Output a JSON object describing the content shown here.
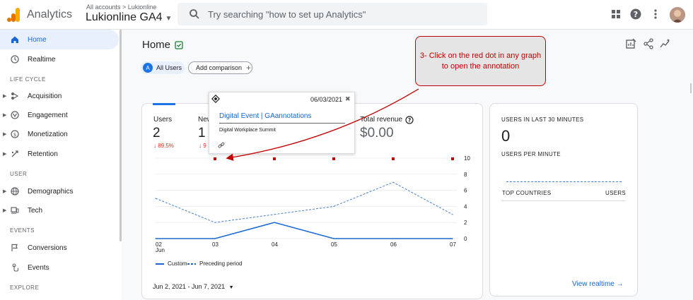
{
  "topbar": {
    "app_name": "Analytics",
    "breadcrumb": "All accounts > Lukionline",
    "property": "Lukionline GA4",
    "search_placeholder": "Try searching \"how to set up Analytics\""
  },
  "sidebar": {
    "items": [
      {
        "label": "Home"
      },
      {
        "label": "Realtime"
      },
      {
        "label": "Acquisition"
      },
      {
        "label": "Engagement"
      },
      {
        "label": "Monetization"
      },
      {
        "label": "Retention"
      },
      {
        "label": "Demographics"
      },
      {
        "label": "Tech"
      },
      {
        "label": "Conversions"
      },
      {
        "label": "Events"
      }
    ],
    "sections": [
      "LIFE CYCLE",
      "USER",
      "EVENTS",
      "EXPLORE"
    ]
  },
  "home": {
    "title": "Home",
    "chip_users_letter": "A",
    "chip_users": "All Users",
    "add_comparison": "Add comparison"
  },
  "metrics": {
    "users_label": "Users",
    "users_value": "2",
    "users_change": "↓ 89.5%",
    "new_label": "New",
    "new_value": "1",
    "new_change": "↓ 9",
    "revenue_label": "Total revenue",
    "revenue_value": "$0.00"
  },
  "annotation": {
    "date": "06/03/2021",
    "close": "✖",
    "title": "Digital Event | GAannotations",
    "subtitle": "Digital Workplace Summit"
  },
  "callout": "3- Click on the red dot in any graph to open the annotation",
  "chart_data": {
    "type": "line",
    "categories": [
      "02 Jun",
      "03",
      "04",
      "05",
      "06",
      "07"
    ],
    "x_tick_top": [
      "02",
      "03",
      "04",
      "05",
      "06",
      "07"
    ],
    "x_tick_sub": [
      "Jun",
      "",
      "",
      "",
      "",
      ""
    ],
    "series": [
      {
        "name": "Custom",
        "values": [
          0,
          0,
          2,
          0,
          0,
          0
        ],
        "style": "solid",
        "color": "#1967d2"
      },
      {
        "name": "Preceding period",
        "values": [
          5,
          2,
          3,
          4,
          7,
          3
        ],
        "style": "dashed",
        "color": "#4a80c8"
      }
    ],
    "y_right_ticks": [
      "10",
      "8",
      "6",
      "4",
      "2",
      "0"
    ],
    "annotation_markers": [
      "03",
      "04",
      "05",
      "06",
      "07"
    ],
    "marker_color": "#c00000",
    "date_range": "Jun 2, 2021 - Jun 7, 2021"
  },
  "realtime": {
    "users_30_label": "USERS IN LAST 30 MINUTES",
    "users_30_value": "0",
    "per_minute_label": "USERS PER MINUTE",
    "top_countries": "TOP COUNTRIES",
    "users_col": "USERS",
    "link": "View realtime →"
  }
}
